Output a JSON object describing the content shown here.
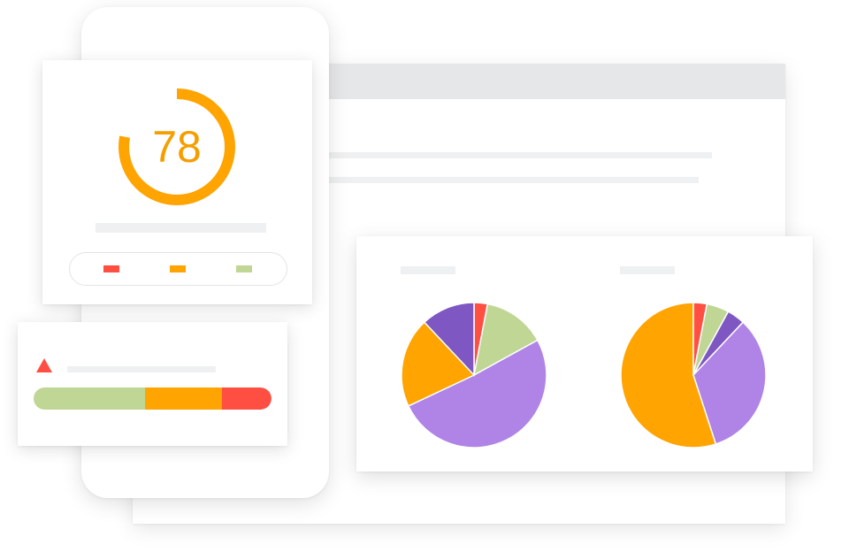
{
  "colors": {
    "orange": "#FFA400",
    "red": "#FF4E42",
    "green": "#C0D695",
    "purple": "#B084E6",
    "dark_purple": "#7E57C2",
    "placeholder": "#EFF0F1"
  },
  "score_card": {
    "score": "78",
    "score_fraction": 0.78,
    "legend": [
      {
        "color": "#FF4E42"
      },
      {
        "color": "#FFA400"
      },
      {
        "color": "#C0D695"
      }
    ]
  },
  "alert_card": {
    "icon": "warning-triangle-icon",
    "segments": [
      {
        "color": "#C0D695",
        "fraction": 0.47
      },
      {
        "color": "#FFA400",
        "fraction": 0.32
      },
      {
        "color": "#FF4E42",
        "fraction": 0.21
      }
    ]
  },
  "chart_data": [
    {
      "type": "pie",
      "slices": [
        {
          "color": "#FF4E42",
          "value": 3
        },
        {
          "color": "#C0D695",
          "value": 14
        },
        {
          "color": "#B084E6",
          "value": 51
        },
        {
          "color": "#FFA400",
          "value": 20
        },
        {
          "color": "#7E57C2",
          "value": 12
        }
      ]
    },
    {
      "type": "pie",
      "slices": [
        {
          "color": "#FF4E42",
          "value": 3
        },
        {
          "color": "#C0D695",
          "value": 5
        },
        {
          "color": "#7E57C2",
          "value": 4
        },
        {
          "color": "#B084E6",
          "value": 33
        },
        {
          "color": "#FFA400",
          "value": 55
        }
      ]
    }
  ]
}
